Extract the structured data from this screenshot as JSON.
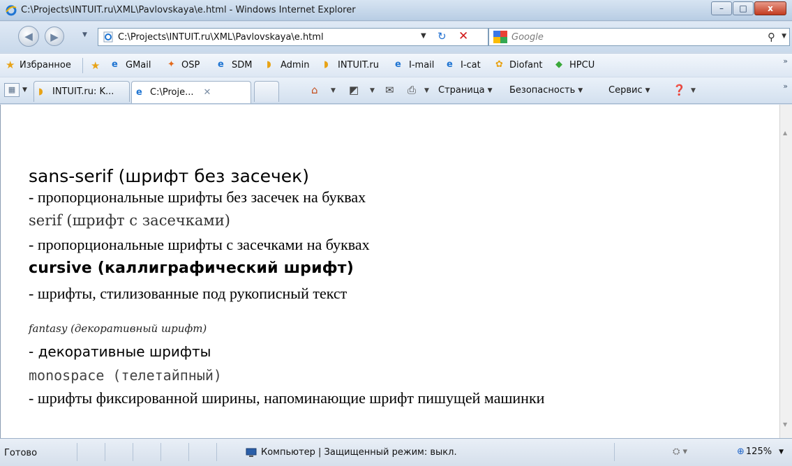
{
  "window": {
    "title": "C:\\Projects\\INTUIT.ru\\XML\\Pavlovskaya\\e.html - Windows Internet Explorer",
    "minimize": "–",
    "maximize": "□",
    "close": "x"
  },
  "address_bar": {
    "url": "C:\\Projects\\INTUIT.ru\\XML\\Pavlovskaya\\e.html",
    "search_placeholder": "Google"
  },
  "favorites_bar": {
    "favorites_label": "Избранное",
    "items": [
      "GMail",
      "OSP",
      "SDM",
      "Admin",
      "INTUIT.ru",
      "I-mail",
      "I-cat",
      "Diofant",
      "HPCU"
    ]
  },
  "tabs": [
    {
      "label": "INTUIT.ru: K..."
    },
    {
      "label": "C:\\Proje..."
    }
  ],
  "command_bar": {
    "page": "Страница",
    "safety": "Безопасность",
    "tools": "Сервис"
  },
  "content": {
    "lines": [
      "sans-serif (шрифт без засечек)",
      "- пропорциональные шрифты без засечек на буквах",
      "serif (шрифт с засечками)",
      "- пропорциональные шрифты с засечками на буквах",
      "cursive (каллиграфический шрифт)",
      "- шрифты, стилизованные под рукописный текст",
      "fantasy (декоративный шрифт)",
      "- декоративные шрифты",
      "monospace (телетайпный)",
      "- шрифты фиксированной ширины, напоминающие шрифт пишущей машинки"
    ]
  },
  "status_bar": {
    "status": "Готово",
    "zone": "Компьютер | Защищенный режим: выкл.",
    "zoom": "125%"
  },
  "colors": {
    "chrome": "#d3e0ef",
    "close_button": "#c23b1f",
    "content_bg": "#ffffff"
  }
}
